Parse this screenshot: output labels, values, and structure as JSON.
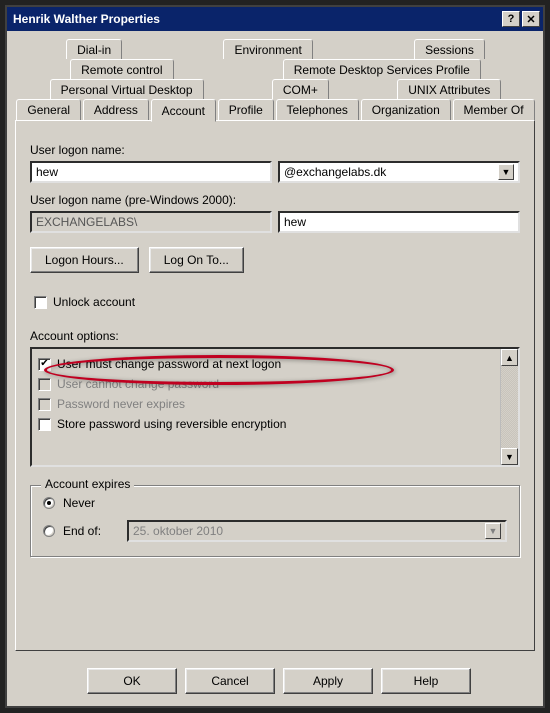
{
  "window": {
    "title": "Henrik Walther Properties"
  },
  "tabs": {
    "row1": [
      "Dial-in",
      "Environment",
      "Sessions"
    ],
    "row2": [
      "Remote control",
      "Remote Desktop Services Profile"
    ],
    "row3": [
      "Personal Virtual Desktop",
      "COM+",
      "UNIX Attributes"
    ],
    "row4": [
      "General",
      "Address",
      "Account",
      "Profile",
      "Telephones",
      "Organization",
      "Member Of"
    ]
  },
  "account": {
    "logon_label": "User logon name:",
    "logon_value": "hew",
    "domain_value": "@exchangelabs.dk",
    "pre2000_label": "User logon name (pre-Windows 2000):",
    "pre2000_domain": "EXCHANGELABS\\",
    "pre2000_user": "hew",
    "logon_hours_btn": "Logon Hours...",
    "log_on_to_btn": "Log On To...",
    "unlock_label": "Unlock account",
    "options_label": "Account options:",
    "options": [
      {
        "label": "User must change password at next logon",
        "checked": true
      },
      {
        "label": "User cannot change password",
        "checked": false
      },
      {
        "label": "Password never expires",
        "checked": false
      },
      {
        "label": "Store password using reversible encryption",
        "checked": false
      }
    ],
    "expires": {
      "legend": "Account expires",
      "never": "Never",
      "end_of": "End of:",
      "date": "25.  oktober   2010"
    }
  },
  "buttons": {
    "ok": "OK",
    "cancel": "Cancel",
    "apply": "Apply",
    "help": "Help"
  }
}
